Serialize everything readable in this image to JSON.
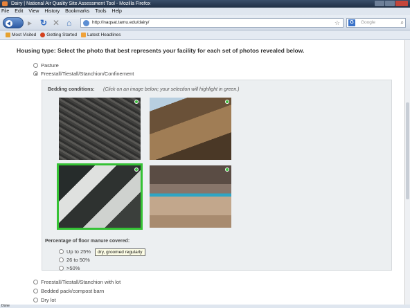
{
  "window": {
    "title": "Dairy | National Air Quality Site Assessment Tool - Mozilla Firefox"
  },
  "menu": {
    "items": [
      "File",
      "Edit",
      "View",
      "History",
      "Bookmarks",
      "Tools",
      "Help"
    ]
  },
  "nav": {
    "url": "http://naqsat.tamu.edu/dairy/",
    "search_placeholder": "Google"
  },
  "bookmarks": {
    "items": [
      {
        "label": "Most Visited",
        "icon": "star-icon",
        "color": "#e6a230"
      },
      {
        "label": "Getting Started",
        "icon": "firefox-icon",
        "color": "#d4411e"
      },
      {
        "label": "Latest Headlines",
        "icon": "rss-icon",
        "color": "#f0a23a"
      }
    ]
  },
  "page": {
    "heading": "Housing type: Select the photo that best represents your facility for each set of photos revealed below.",
    "housing_options": [
      {
        "label": "Pasture",
        "checked": false
      },
      {
        "label": "Freestall/Tiestall/Stanchion/Confinement",
        "checked": true
      },
      {
        "label": "Freestall/Tiestall/Stanchion with lot",
        "checked": false
      },
      {
        "label": "Bedded pack/compost barn",
        "checked": false
      },
      {
        "label": "Dry lot",
        "checked": false
      }
    ],
    "bedding": {
      "label": "Bedding conditions:",
      "hint": "(Click on an image below; your selection will highlight in green.)",
      "tooltip": "dry, groomed regularly",
      "selected_index": 2
    },
    "manure": {
      "label": "Percentage of floor manure covered:",
      "options": [
        "Up to 25%",
        "26 to 50%",
        ">50%"
      ]
    }
  },
  "status": {
    "text": "Done"
  },
  "colors": {
    "accent_selected": "#35c235",
    "panel_bg": "#eceff1"
  }
}
